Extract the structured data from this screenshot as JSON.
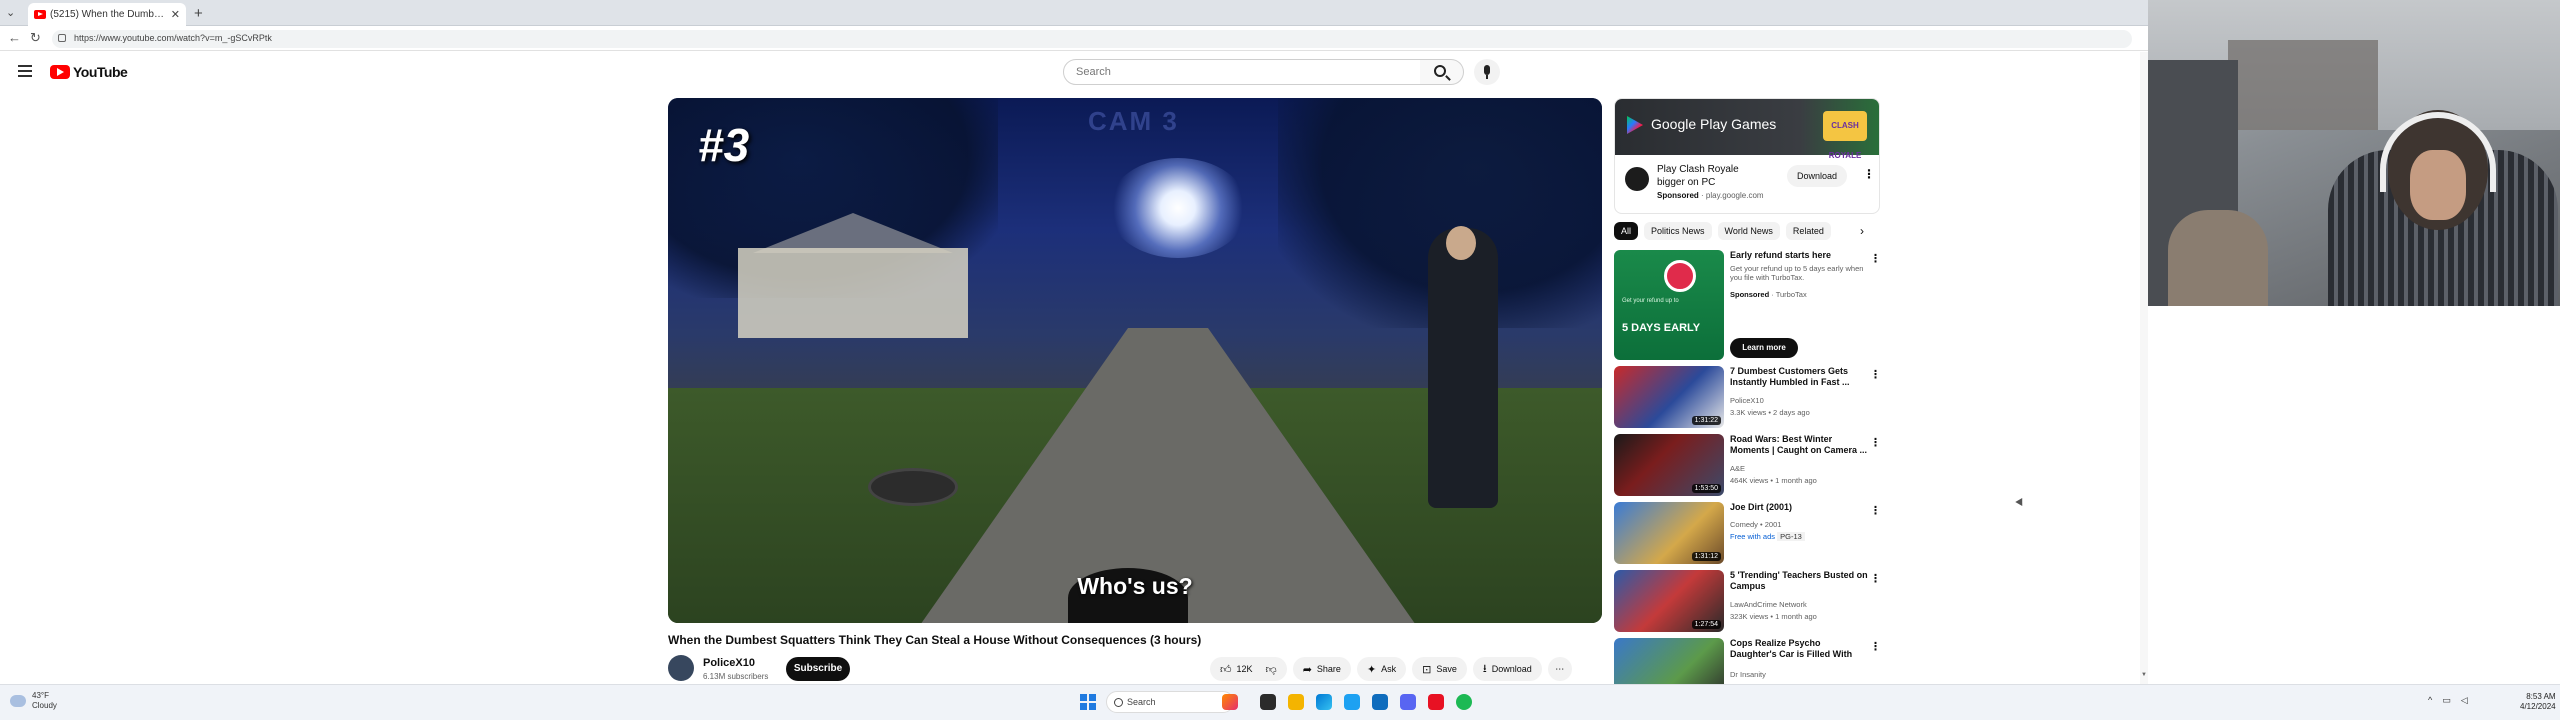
{
  "browser": {
    "tab_title": "(5215) When the Dumbest S...",
    "address": "https://www.youtube.com/watch?v=m_-gSCvRPtk"
  },
  "header": {
    "logo_text": "YouTube",
    "search_placeholder": "Search"
  },
  "player": {
    "episode_label": "#3",
    "cam_label": "CAM 3",
    "caption": "Who's us?"
  },
  "video": {
    "title": "When the Dumbest Squatters Think They Can Steal a House Without Consequences (3 hours)",
    "channel": "PoliceX10",
    "subscribers": "6.13M subscribers",
    "subscribe_label": "Subscribe",
    "likes": "12K",
    "share_label": "Share",
    "ask_label": "Ask",
    "save_label": "Save",
    "download_label": "Download"
  },
  "sidebar_ad": {
    "banner_text": "Google Play Games",
    "game_logo": "CLASH ROYALE",
    "title": "Play Clash Royale bigger on PC",
    "sponsored": "Sponsored",
    "domain": "play.google.com",
    "download_label": "Download"
  },
  "chips": [
    "All",
    "Politics News",
    "World News",
    "Related"
  ],
  "turbotax_ad": {
    "title": "Early refund starts here",
    "description": "Get your refund up to 5 days early when you file with TurboTax.",
    "sponsored": "Sponsored",
    "advertiser": "TurboTax",
    "thumb_small": "Get your refund up to",
    "thumb_big": "5 DAYS EARLY",
    "cta": "Learn more"
  },
  "recommendations": [
    {
      "title": "7 Dumbest Customers Gets Instantly Humbled in Fast ...",
      "channel": "PoliceX10",
      "meta": "3.3K views • 2 days ago",
      "duration": "1:31:22"
    },
    {
      "title": "Road Wars: Best Winter Moments | Caught on Camera ...",
      "channel": "A&E",
      "meta": "464K views • 1 month ago",
      "duration": "1:53:50"
    },
    {
      "title": "Joe Dirt (2001)",
      "channel": "Comedy • 2001",
      "meta_free": "Free with ads",
      "meta_rating": "PG-13",
      "duration": "1:31:12"
    },
    {
      "title": "5 'Trending' Teachers Busted on Campus",
      "channel": "LawAndCrime Network",
      "meta": "323K views • 1 month ago",
      "duration": "1:27:54"
    },
    {
      "title": "Cops Realize Psycho Daughter's Car is Filled With Bodies",
      "channel": "Dr Insanity",
      "meta": "",
      "duration": ""
    }
  ],
  "taskbar": {
    "temp": "43°F",
    "condition": "Cloudy",
    "search": "Search",
    "time": "8:53 AM",
    "date": "4/12/2024"
  }
}
